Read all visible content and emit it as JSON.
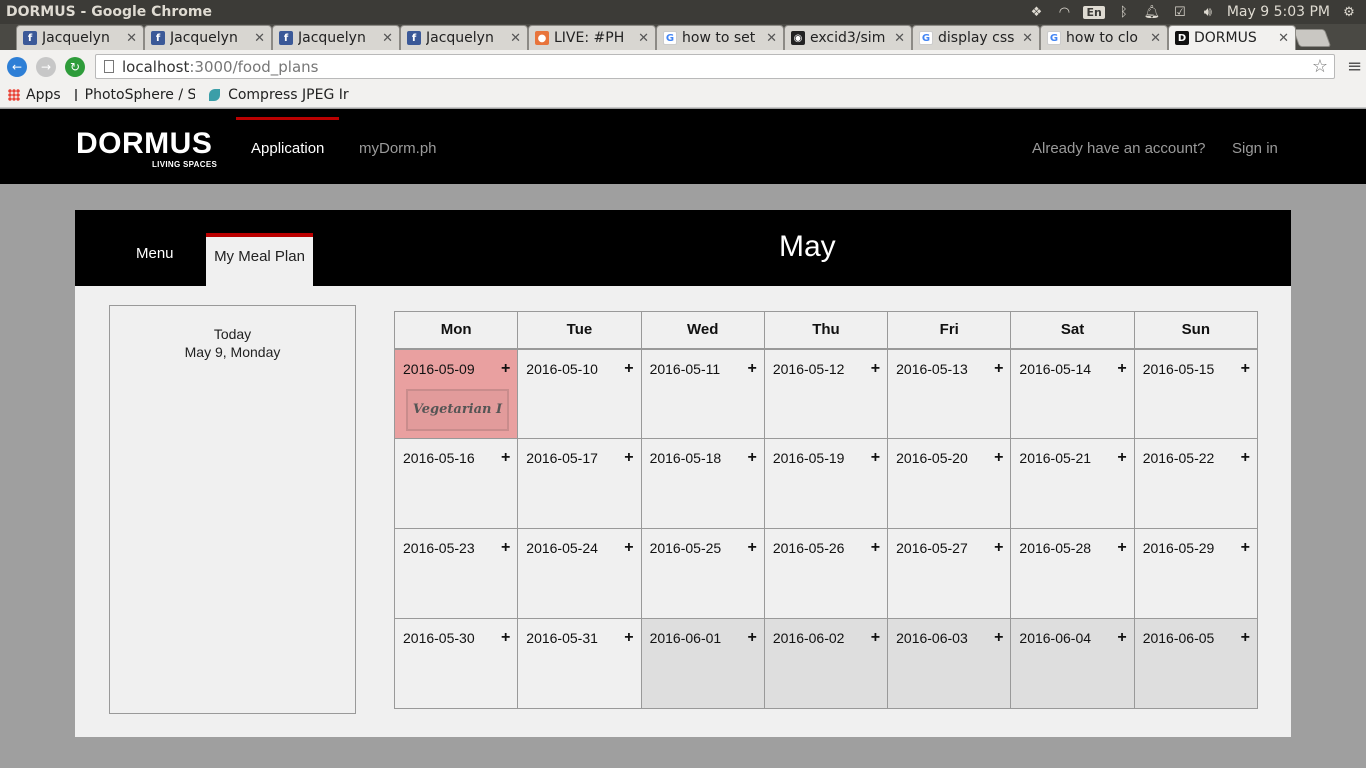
{
  "os": {
    "window_title": "DORMUS - Google Chrome",
    "lang": "En",
    "clock": "May 9  5:03 PM"
  },
  "tabs": [
    {
      "label": "Jacquelyn",
      "favicon": "facebook-icon"
    },
    {
      "label": "Jacquelyn",
      "favicon": "facebook-icon"
    },
    {
      "label": "Jacquelyn",
      "favicon": "facebook-icon"
    },
    {
      "label": "Jacquelyn",
      "favicon": "facebook-icon"
    },
    {
      "label": "LIVE: #PH",
      "favicon": "live-icon"
    },
    {
      "label": "how to set",
      "favicon": "google-icon"
    },
    {
      "label": "excid3/sim",
      "favicon": "github-icon"
    },
    {
      "label": "display css",
      "favicon": "google-icon"
    },
    {
      "label": "how to clo",
      "favicon": "google-icon"
    },
    {
      "label": "DORMUS",
      "favicon": "dormus-icon",
      "active": true
    }
  ],
  "address": {
    "host": "localhost",
    "path": ":3000/food_plans"
  },
  "bookmarks": [
    {
      "label": "Apps"
    },
    {
      "label": "PhotoSphere / St"
    },
    {
      "label": "Compress JPEG Ir"
    }
  ],
  "site": {
    "logo": "DORMUS",
    "logo_sub": "LIVING SPACES",
    "nav": [
      {
        "label": "Application"
      },
      {
        "label": "myDorm.ph"
      }
    ],
    "account_prompt": "Already have an account?",
    "sign_in": "Sign in"
  },
  "panel": {
    "tabs": [
      "Menu",
      "My Meal Plan"
    ],
    "month": "May",
    "today_label": "Today",
    "today_date": "May 9, Monday"
  },
  "calendar": {
    "weekdays": [
      "Mon",
      "Tue",
      "Wed",
      "Thu",
      "Fri",
      "Sat",
      "Sun"
    ],
    "weeks": [
      [
        "2016-05-09",
        "2016-05-10",
        "2016-05-11",
        "2016-05-12",
        "2016-05-13",
        "2016-05-14",
        "2016-05-15"
      ],
      [
        "2016-05-16",
        "2016-05-17",
        "2016-05-18",
        "2016-05-19",
        "2016-05-20",
        "2016-05-21",
        "2016-05-22"
      ],
      [
        "2016-05-23",
        "2016-05-24",
        "2016-05-25",
        "2016-05-26",
        "2016-05-27",
        "2016-05-28",
        "2016-05-29"
      ],
      [
        "2016-05-30",
        "2016-05-31",
        "2016-06-01",
        "2016-06-02",
        "2016-06-03",
        "2016-06-04",
        "2016-06-05"
      ]
    ],
    "add_symbol": "+",
    "meal": {
      "date": "2016-05-09",
      "label": "Vegetarian I"
    }
  },
  "colors": {
    "accent": "#bb0000",
    "today_cell": "#e9a0a0",
    "other_month_cell": "#dedede"
  }
}
